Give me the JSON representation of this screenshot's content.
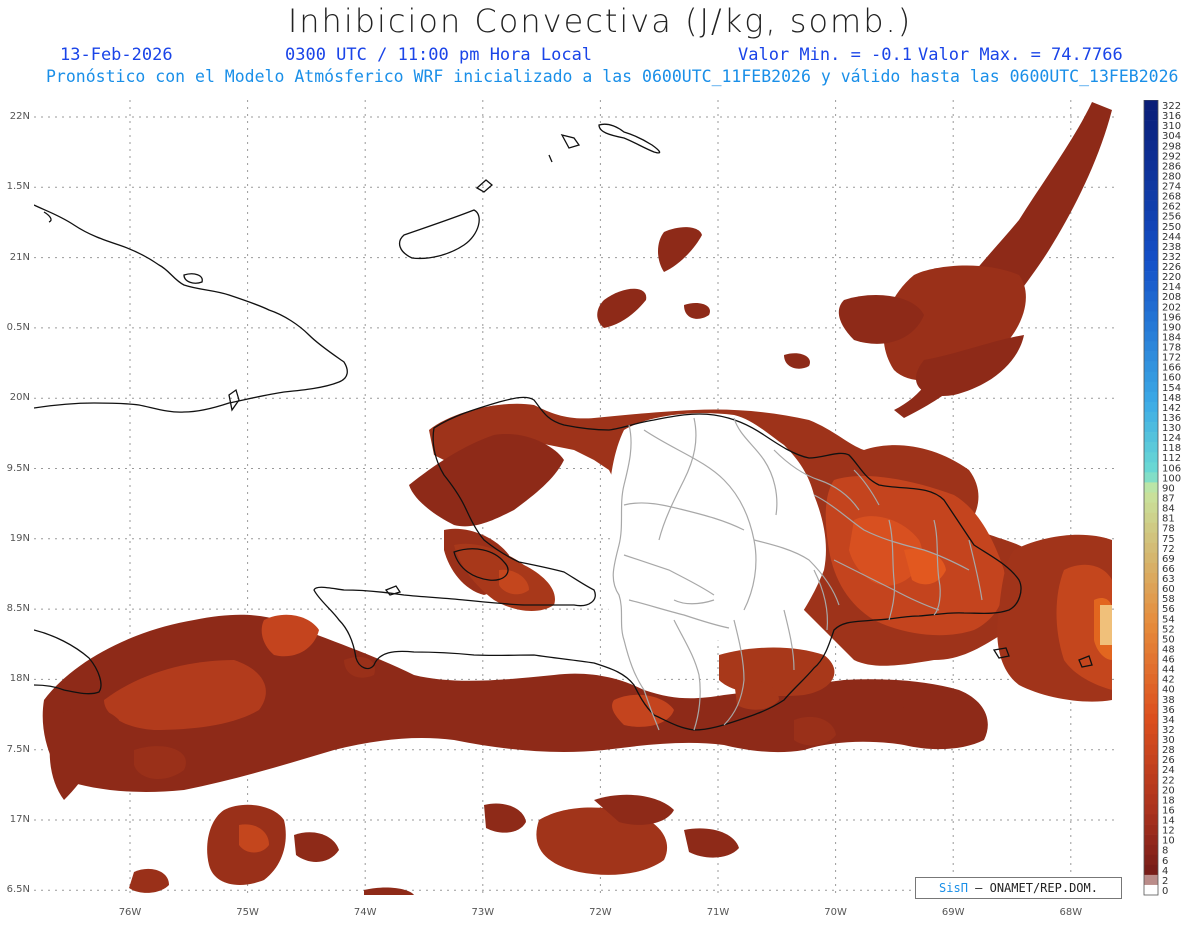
{
  "header": {
    "title": "Inhibicion Convectiva (J/kg, somb.)",
    "date": "13-Feb-2026",
    "time": "0300 UTC / 11:00 pm Hora Local",
    "min_label": "Valor Min. = -0.1",
    "max_label": "Valor Max. = 74.7766",
    "forecast_note": "Pronóstico con el Modelo Atmósferico WRF inicializado a las 0600UTC_11FEB2026 y válido hasta las  0600UTC_13FEB2026"
  },
  "axes": {
    "lat_labels": [
      "22N",
      "1.5N",
      "21N",
      "0.5N",
      "20N",
      "9.5N",
      "19N",
      "8.5N",
      "18N",
      "7.5N",
      "17N",
      "6.5N"
    ],
    "lon_labels": [
      "76W",
      "75W",
      "74W",
      "73W",
      "72W",
      "71W",
      "70W",
      "69W",
      "68W"
    ]
  },
  "colorbar": {
    "levels": [
      "322",
      "316",
      "310",
      "304",
      "298",
      "292",
      "286",
      "280",
      "274",
      "268",
      "262",
      "256",
      "250",
      "244",
      "238",
      "232",
      "226",
      "220",
      "214",
      "208",
      "202",
      "196",
      "190",
      "184",
      "178",
      "172",
      "166",
      "160",
      "154",
      "148",
      "142",
      "136",
      "130",
      "124",
      "118",
      "112",
      "106",
      "100",
      "90",
      "87",
      "84",
      "81",
      "78",
      "75",
      "72",
      "69",
      "66",
      "63",
      "60",
      "58",
      "56",
      "54",
      "52",
      "50",
      "48",
      "46",
      "44",
      "42",
      "40",
      "38",
      "36",
      "34",
      "32",
      "30",
      "28",
      "26",
      "24",
      "22",
      "20",
      "18",
      "16",
      "14",
      "12",
      "10",
      "8",
      "6",
      "4",
      "2",
      "0"
    ]
  },
  "credit": {
    "logo": "SisΠ",
    "text": " – ONAMET/REP.DOM."
  },
  "colors": {
    "field_dark": "#8e2a18",
    "field_mid": "#b23b1c",
    "field_hot": "#e0541e",
    "coast": "#111111",
    "province": "#a8a8a8",
    "title_blue": "#1a44e8",
    "note_blue": "#1a8fe8"
  }
}
